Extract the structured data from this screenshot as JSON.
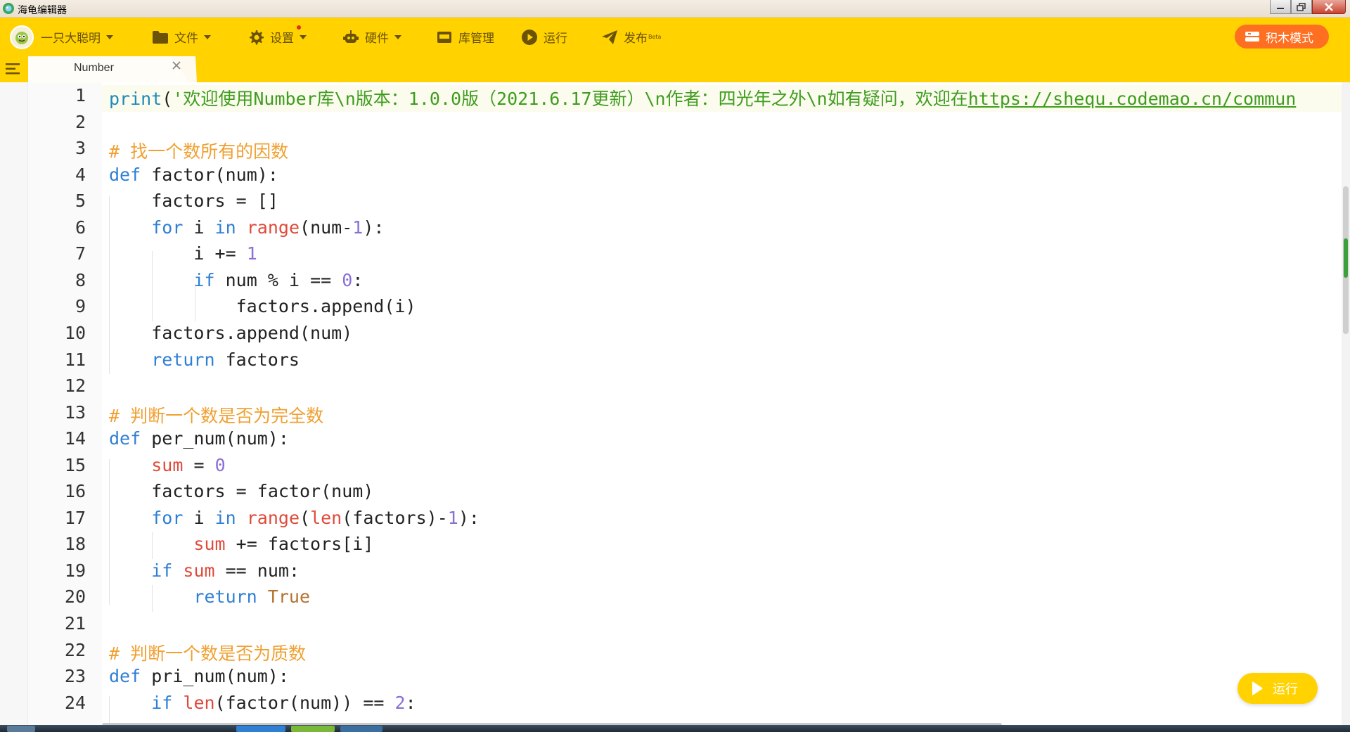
{
  "window": {
    "title": "海龟编辑器",
    "icons": {
      "app": "turtle-logo-icon",
      "minimize": "minimize-icon",
      "maximize": "restore-icon",
      "close": "close-icon"
    }
  },
  "toolbar": {
    "user": {
      "label": "一只大聪明",
      "icon": "user-avatar-icon"
    },
    "file": {
      "label": "文件",
      "icon": "folder-icon"
    },
    "settings": {
      "label": "设置",
      "icon": "gear-icon"
    },
    "hardware": {
      "label": "硬件",
      "icon": "robot-icon"
    },
    "library": {
      "label": "库管理",
      "icon": "library-icon"
    },
    "run": {
      "label": "运行",
      "icon": "play-icon"
    },
    "publish": {
      "label": "发布",
      "badge": "Beta",
      "icon": "send-icon"
    },
    "block_mode": {
      "label": "积木模式",
      "icon": "blocks-icon"
    },
    "accent": "#ffd200",
    "text_color": "#6a5208"
  },
  "tabs": [
    {
      "label": "Number",
      "active": true
    }
  ],
  "editor": {
    "line_numbers": [
      "1",
      "2",
      "3",
      "4",
      "5",
      "6",
      "7",
      "8",
      "9",
      "10",
      "11",
      "12",
      "13",
      "14",
      "15",
      "16",
      "17",
      "18",
      "19",
      "20",
      "21",
      "22",
      "23",
      "24"
    ],
    "lines": [
      "print('欢迎使用Number库\\n版本：1.0.0版（2021.6.17更新）\\n作者：四光年之外\\n如有疑问，欢迎在https://shequ.codemao.cn/commun",
      "",
      "# 找一个数所有的因数",
      "def factor(num):",
      "    factors = []",
      "    for i in range(num-1):",
      "        i += 1",
      "        if num % i == 0:",
      "            factors.append(i)",
      "    factors.append(num)",
      "    return factors",
      "",
      "# 判断一个数是否为完全数",
      "def per_num(num):",
      "    sum = 0",
      "    factors = factor(num)",
      "    for i in range(len(factors)-1):",
      "        sum += factors[i]",
      "    if sum == num:",
      "        return True",
      "",
      "# 判断一个数是否为质数",
      "def pri_num(num):",
      "    if len(factor(num)) == 2:"
    ],
    "syntax_colors": {
      "keyword": "#2f7fd4",
      "string": "#3e9d1e",
      "comment": "#f0a030",
      "number": "#8a6fd6",
      "builtin": "#e04a3a",
      "constant": "#b5722e"
    }
  },
  "float_run": {
    "label": "运行",
    "icon": "play-icon"
  }
}
